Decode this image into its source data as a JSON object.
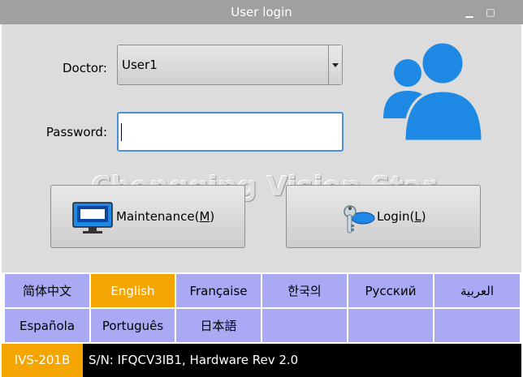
{
  "window": {
    "title": "User login",
    "minimize_glyph": "▁",
    "maximize_glyph": "□"
  },
  "form": {
    "doctor_label": "Doctor:",
    "doctor_value": "User1",
    "password_label": "Password:",
    "password_value": ""
  },
  "watermark": "Chongqing Vision Star",
  "buttons": {
    "maintenance": {
      "label": "Maintenance(",
      "mnemonic": "M",
      "suffix": ")"
    },
    "login": {
      "label": "Login(",
      "mnemonic": "L",
      "suffix": ")"
    }
  },
  "languages": {
    "row1": [
      "简体中文",
      "English",
      "Française",
      "한국의",
      "Русский",
      "العربية"
    ],
    "row2": [
      "Española",
      "Português",
      "日本語",
      "",
      "",
      ""
    ],
    "selected": "English"
  },
  "status": {
    "model": "IVS-201B",
    "serial_info": "S/N: IFQCV3IB1, Hardware Rev 2.0"
  },
  "icons": {
    "users": "users-icon",
    "monitor": "monitor-icon",
    "keys": "keys-icon"
  },
  "colors": {
    "accent": "#f5a500",
    "language_cell": "#a9a9f4",
    "icon_blue": "#1e88e5",
    "focus": "#4a90d9"
  }
}
